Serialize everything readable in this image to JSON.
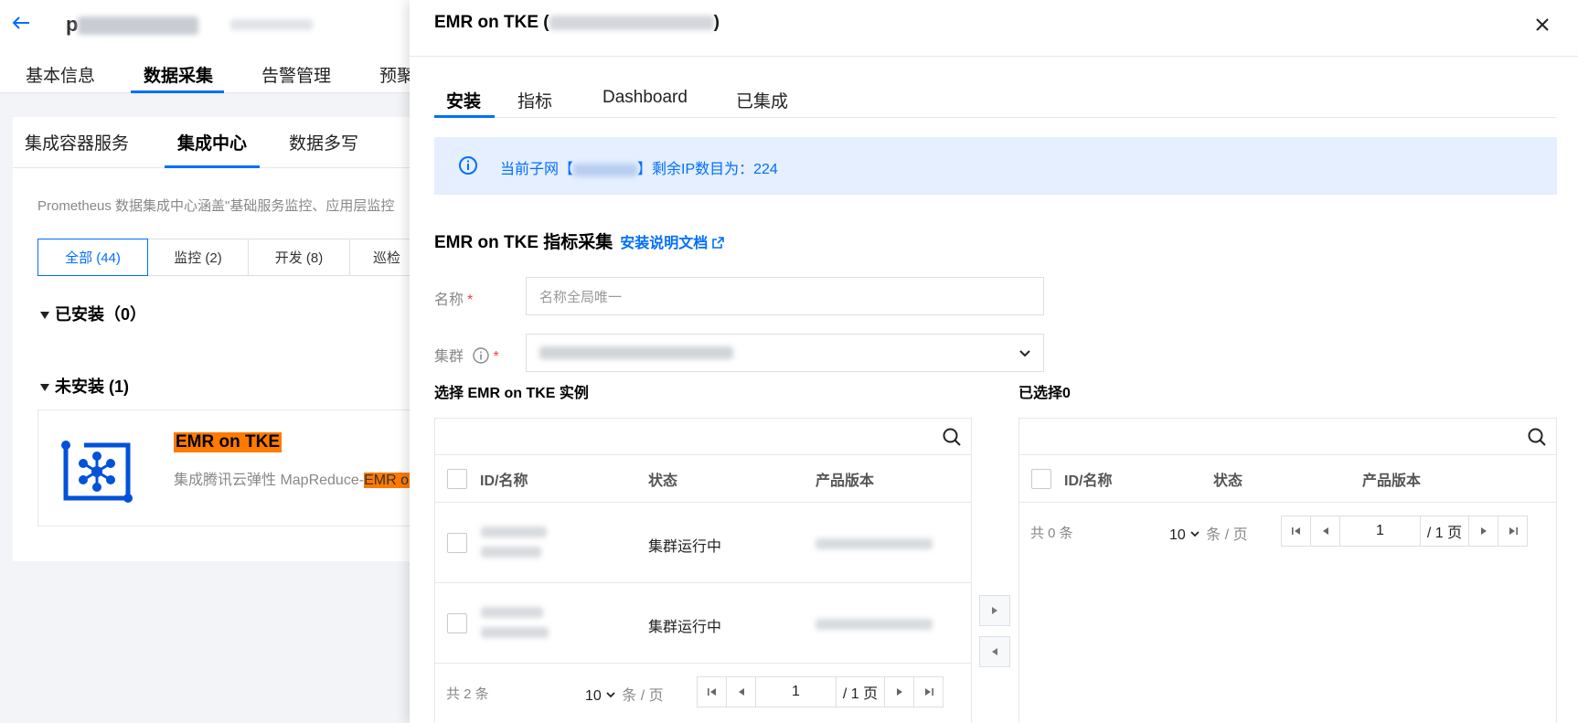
{
  "bg": {
    "tabs": [
      "基本信息",
      "数据采集",
      "告警管理",
      "预聚"
    ],
    "card_tabs": [
      "集成容器服务",
      "集成中心",
      "数据多写"
    ],
    "desc": "Prometheus 数据集成中心涵盖\"基础服务监控、应用层监控",
    "filters": [
      "全部 (44)",
      "监控 (2)",
      "开发 (8)",
      "巡检"
    ],
    "installed": "已安装（0）",
    "not_installed": "未安装 (1)",
    "product": {
      "name": "EMR on TKE",
      "desc_prefix": "集成腾讯云弹性 MapReduce-",
      "desc_hl": "EMR on TKE"
    }
  },
  "drawer": {
    "title_prefix": "EMR on TKE (",
    "title_suffix": ")",
    "tabs": [
      "安装",
      "指标",
      "Dashboard",
      "已集成"
    ],
    "alert_prefix": "当前子网【",
    "alert_suffix": "】剩余IP数目为：224",
    "form_title": "EMR on TKE 指标采集",
    "doc_link": "安装说明文档",
    "name_label": "名称",
    "name_placeholder": "名称全局唯一",
    "cluster_label": "集群",
    "left_title": "选择 EMR on TKE 实例",
    "right_title": "已选择0",
    "columns": [
      "ID/名称",
      "状态",
      "产品版本"
    ],
    "rows": [
      {
        "status": "集群运行中"
      },
      {
        "status": "集群运行中"
      }
    ],
    "left_pager": {
      "total": "共 2 条",
      "size": "10",
      "unit": "条 / 页",
      "page": "1",
      "pages": "/ 1 页"
    },
    "right_pager": {
      "total": "共 0 条",
      "size": "10",
      "unit": "条 / 页",
      "page": "1",
      "pages": "/ 1 页"
    }
  }
}
